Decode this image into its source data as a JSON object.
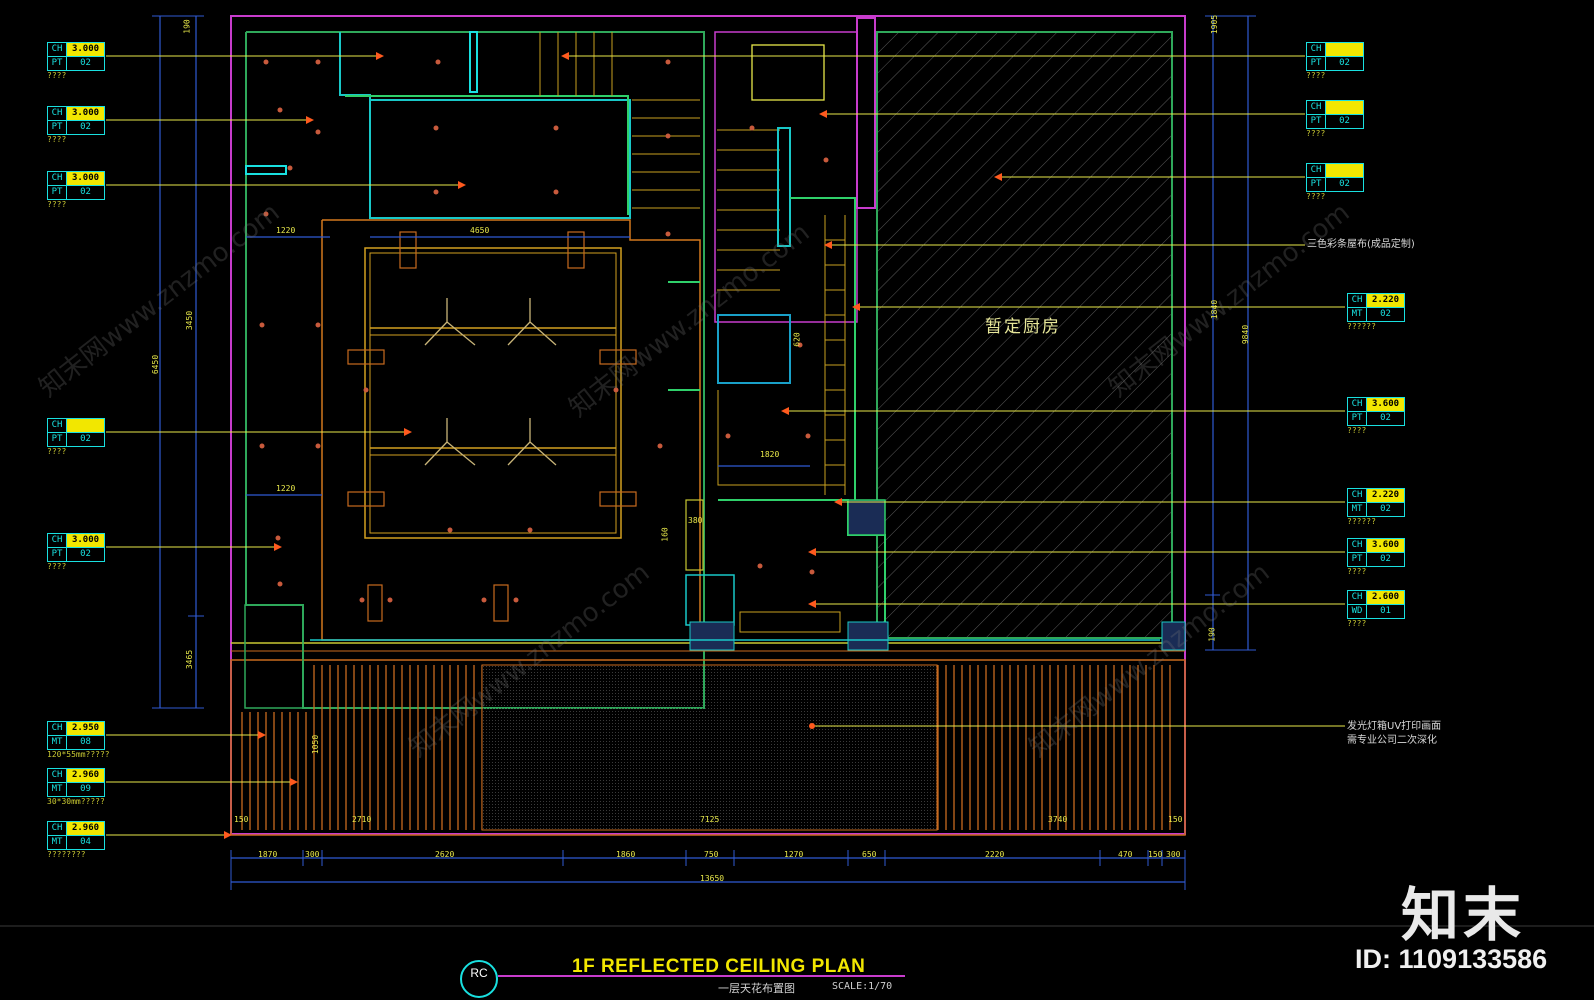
{
  "drawing": {
    "kitchen_label": "暂定厨房",
    "title": "1F REFLECTED CEILING PLAN",
    "subtitle": "一层天花布置图",
    "scale": "SCALE:1/70",
    "callout_symbol": "RC"
  },
  "brand": {
    "logo": "知末",
    "id_text": "ID: 1109133586",
    "watermark": "知末网www.znzmo.com"
  },
  "left_tags": [
    {
      "ch": "3.000",
      "mat": "PT",
      "code": "02",
      "note": "????"
    },
    {
      "ch": "3.000",
      "mat": "PT",
      "code": "02",
      "note": "????"
    },
    {
      "ch": "3.000",
      "mat": "PT",
      "code": "02",
      "note": "????"
    },
    {
      "ch": "",
      "mat": "PT",
      "code": "02",
      "note": "????"
    },
    {
      "ch": "3.000",
      "mat": "PT",
      "code": "02",
      "note": "????"
    },
    {
      "ch": "2.950",
      "mat": "MT",
      "code": "08",
      "note": "120*55mm?????"
    },
    {
      "ch": "2.960",
      "mat": "MT",
      "code": "09",
      "note": "30*30mm?????"
    },
    {
      "ch": "2.960",
      "mat": "MT",
      "code": "04",
      "note": "????????"
    }
  ],
  "right_tags": [
    {
      "ch": "",
      "mat": "PT",
      "code": "02",
      "note": "????"
    },
    {
      "ch": "",
      "mat": "PT",
      "code": "02",
      "note": "????"
    },
    {
      "ch": "",
      "mat": "PT",
      "code": "02",
      "note": "????"
    },
    {
      "ch": "2.220",
      "mat": "MT",
      "code": "02",
      "note": "??????"
    },
    {
      "ch": "3.600",
      "mat": "PT",
      "code": "02",
      "note": "????"
    },
    {
      "ch": "2.220",
      "mat": "MT",
      "code": "02",
      "note": "??????"
    },
    {
      "ch": "3.600",
      "mat": "PT",
      "code": "02",
      "note": "????"
    },
    {
      "ch": "2.600",
      "mat": "WD",
      "code": "01",
      "note": "????"
    }
  ],
  "right_notes": {
    "tricolor": "三色彩条屋布(成品定制)",
    "lightbox_line1": "发光灯箱UV打印画面",
    "lightbox_line2": "需专业公司二次深化"
  },
  "dimensions": {
    "bottom_chain": [
      "1870",
      "300",
      "2620",
      "1860",
      "750",
      "1270",
      "650",
      "2220",
      "470",
      "150",
      "300"
    ],
    "bottom_total": "13650",
    "strip_labels": [
      "150",
      "2710",
      "7125",
      "3740",
      "150"
    ],
    "left_overall": "6450",
    "left_parts": [
      "3450",
      "3465"
    ],
    "left_small": "380",
    "right_overall": "9840",
    "right_parts": [
      "1840",
      "1905",
      "190"
    ],
    "inner": [
      "1220",
      "4650",
      "1220",
      "1820",
      "620",
      "160",
      "1050"
    ],
    "top_left": "190"
  }
}
